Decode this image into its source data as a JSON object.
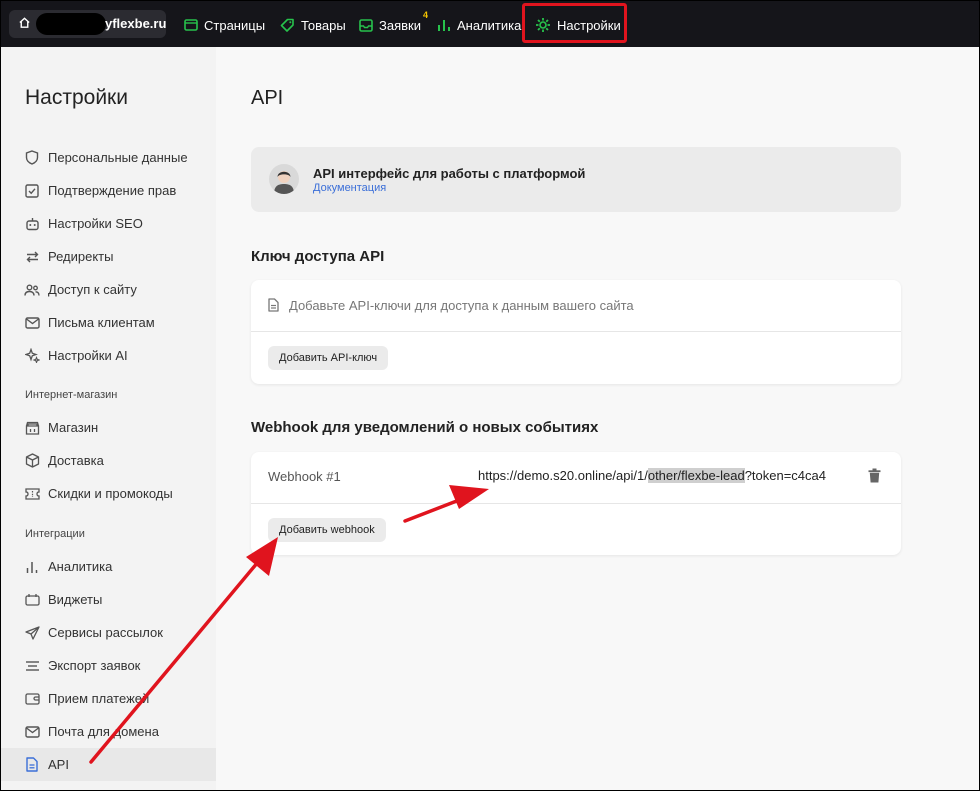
{
  "topbar": {
    "site_domain": "yflexbe.ru",
    "nav": [
      {
        "label": "Страницы",
        "icon": "pages-icon"
      },
      {
        "label": "Товары",
        "icon": "tag-icon"
      },
      {
        "label": "Заявки",
        "icon": "inbox-icon",
        "badge": "4"
      },
      {
        "label": "Аналитика",
        "icon": "analytics-icon"
      },
      {
        "label": "Настройки",
        "icon": "gear-icon",
        "active": true
      }
    ],
    "accent_color": "#27c24c",
    "highlight_color": "#e0141e"
  },
  "sidebar": {
    "title": "Настройки",
    "items": [
      {
        "label": "Персональные данные",
        "icon": "shield-icon"
      },
      {
        "label": "Подтверждение прав",
        "icon": "checkbox-icon"
      },
      {
        "label": "Настройки SEO",
        "icon": "robot-icon"
      },
      {
        "label": "Редиректы",
        "icon": "arrows-icon"
      },
      {
        "label": "Доступ к сайту",
        "icon": "users-icon"
      },
      {
        "label": "Письма клиентам",
        "icon": "mail-icon"
      },
      {
        "label": "Настройки AI",
        "icon": "sparkle-icon"
      }
    ],
    "group_shop": "Интернет-магазин",
    "shop_items": [
      {
        "label": "Магазин",
        "icon": "shop-icon"
      },
      {
        "label": "Доставка",
        "icon": "box-icon"
      },
      {
        "label": "Скидки и промокоды",
        "icon": "ticket-icon"
      }
    ],
    "group_integrations": "Интеграции",
    "integration_items": [
      {
        "label": "Аналитика",
        "icon": "bar-chart-icon"
      },
      {
        "label": "Виджеты",
        "icon": "widget-icon"
      },
      {
        "label": "Сервисы рассылок",
        "icon": "send-icon"
      },
      {
        "label": "Экспорт заявок",
        "icon": "list-icon"
      },
      {
        "label": "Прием платежей",
        "icon": "wallet-icon"
      },
      {
        "label": "Почта для домена",
        "icon": "mail-icon"
      },
      {
        "label": "API",
        "icon": "document-icon",
        "active": true
      }
    ],
    "active_color": "#3b6fd8"
  },
  "main": {
    "title": "API",
    "info": {
      "title": "API интерфейс для работы с платформой",
      "link": "Документация"
    },
    "api_key": {
      "heading": "Ключ доступа API",
      "empty_text": "Добавьте API-ключи для доступа к данным вашего сайта",
      "add_button": "Добавить API-ключ"
    },
    "webhook": {
      "heading": "Webhook для уведомлений о новых событиях",
      "item_label": "Webhook #1",
      "url_prefix": "https://demo.s20.online/api/1/",
      "url_highlight": "other/flexbe-lead",
      "url_suffix": "?token=c4ca4",
      "add_button": "Добавить webhook"
    }
  }
}
